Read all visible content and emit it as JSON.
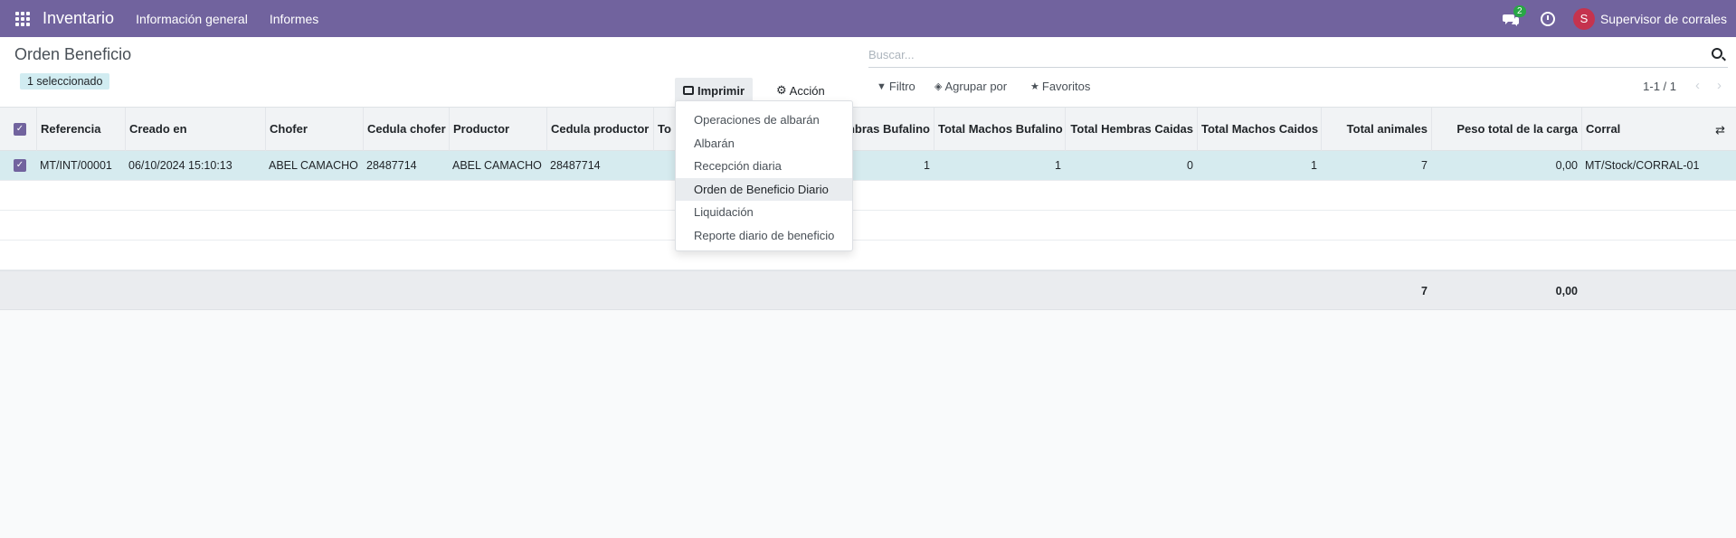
{
  "navbar": {
    "app_name": "Inventario",
    "menus": [
      "Información general",
      "Informes"
    ],
    "chat_badge": "2",
    "user_initial": "S",
    "user_name": "Supervisor de corrales"
  },
  "control_panel": {
    "breadcrumb": "Orden Beneficio",
    "selected_label": "1 seleccionado",
    "print_label": "Imprimir",
    "action_label": "Acción",
    "search_placeholder": "Buscar...",
    "filter_label": "Filtro",
    "groupby_label": "Agrupar por",
    "favorites_label": "Favoritos",
    "pager": "1-1 / 1"
  },
  "table": {
    "columns": [
      "Referencia",
      "Creado en",
      "Chofer",
      "Cedula chofer",
      "Productor",
      "Cedula productor",
      "To",
      "mbras Bufalino",
      "Total Machos Bufalino",
      "Total Hembras Caidas",
      "Total Machos Caidos",
      "Total animales",
      "Peso total de la carga",
      "Corral"
    ],
    "rows": [
      {
        "referencia": "MT/INT/00001",
        "creado_en": "06/10/2024 15:10:13",
        "chofer": "ABEL CAMACHO",
        "cedula_chofer": "28487714",
        "productor": "ABEL CAMACHO",
        "cedula_productor": "28487714",
        "hembras_bufalino": "1",
        "machos_bufalino": "1",
        "hembras_caidas": "0",
        "machos_caidos": "1",
        "total_animales": "7",
        "peso_total": "0,00",
        "corral": "MT/Stock/CORRAL-01"
      }
    ],
    "totals": {
      "total_animales": "7",
      "peso_total": "0,00"
    }
  },
  "print_menu": {
    "items": [
      "Operaciones de albarán",
      "Albarán",
      "Recepción diaria",
      "Orden de Beneficio Diario",
      "Liquidación",
      "Reporte diario de beneficio"
    ],
    "active": "Orden de Beneficio Diario"
  },
  "colors": {
    "navbar": "#71639e",
    "selected_row": "#d6ebef",
    "badge": "#28a745",
    "avatar": "#c5334e"
  }
}
